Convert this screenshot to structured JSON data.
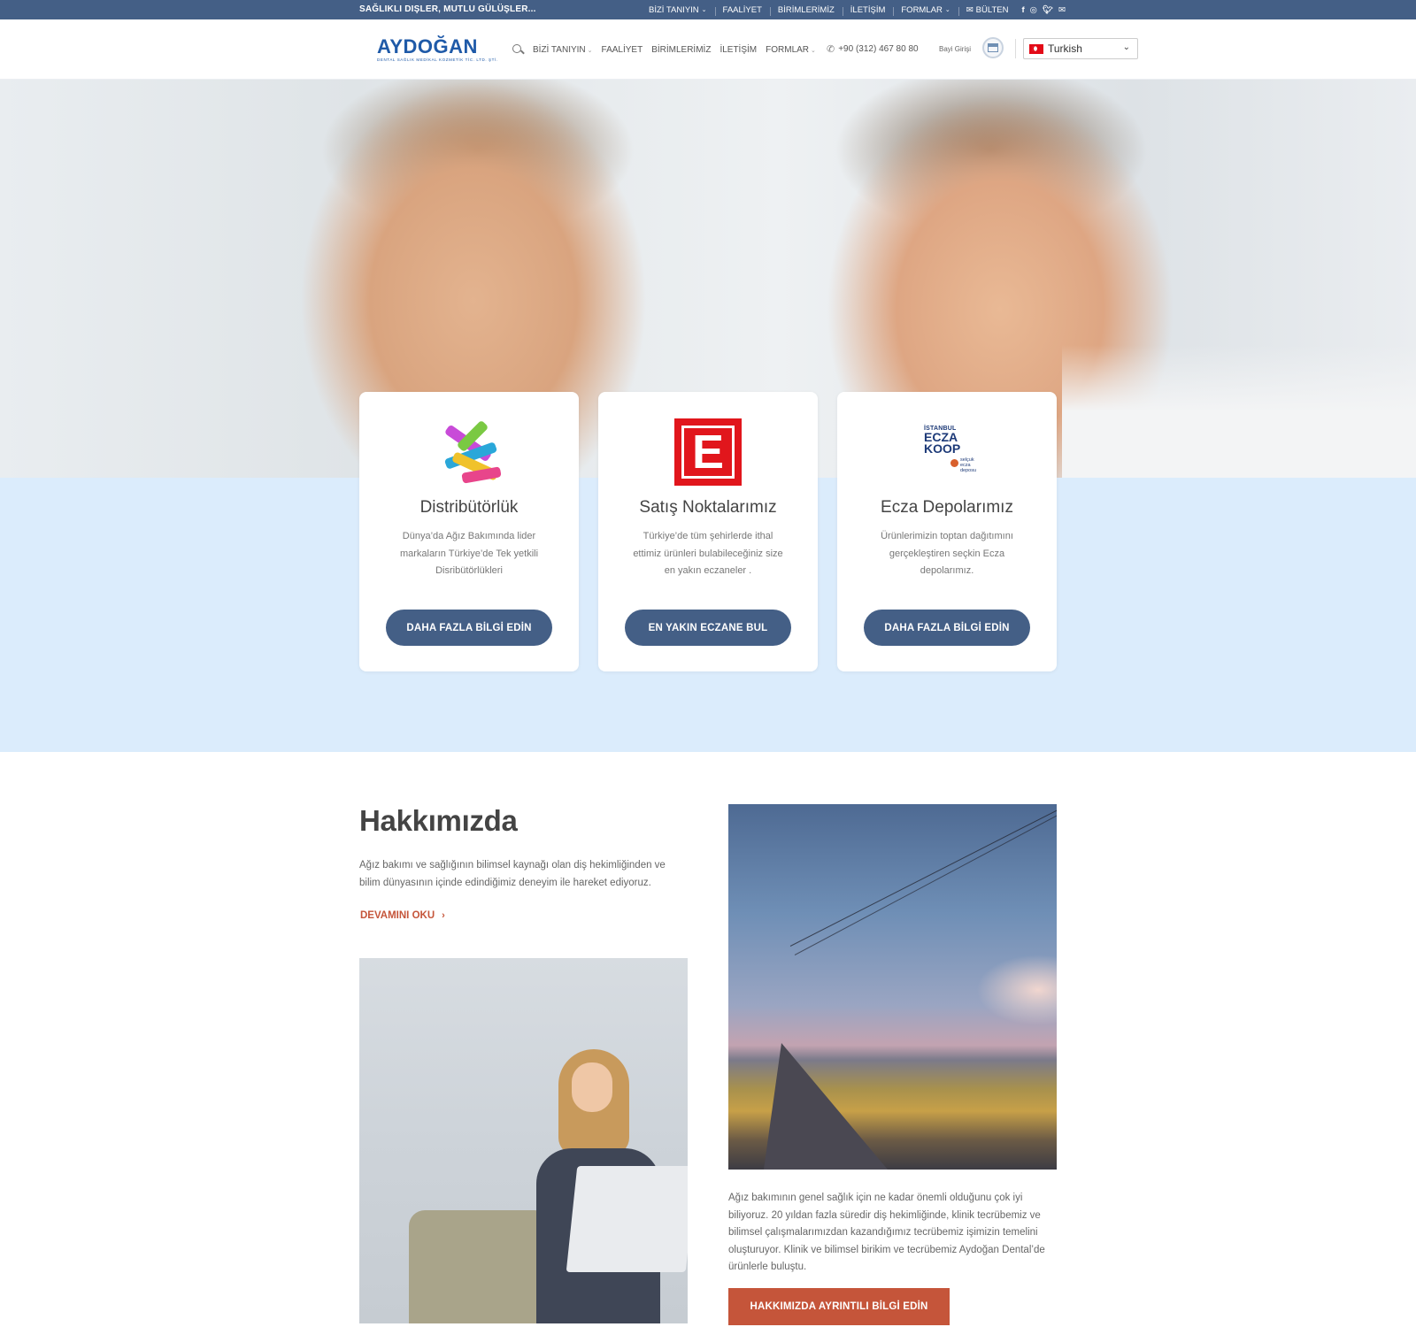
{
  "topbar": {
    "tagline": "SAĞLIKLI DIŞLER, MUTLU GÜLÜŞLER...",
    "nav": [
      {
        "label": "BİZİ TANIYIN",
        "has_dropdown": true
      },
      {
        "label": "FAALİYET",
        "has_dropdown": false
      },
      {
        "label": "BİRİMLERİMİZ",
        "has_dropdown": false
      },
      {
        "label": "İLETİŞİM",
        "has_dropdown": false
      },
      {
        "label": "FORMLAR",
        "has_dropdown": true
      },
      {
        "label": "BÜLTEN",
        "icon": "envelope-icon"
      }
    ],
    "social": [
      "facebook-icon",
      "instagram-icon",
      "twitter-icon",
      "email-icon"
    ],
    "color": "#445f86"
  },
  "header": {
    "logo_text": "AYDOĞAN",
    "logo_subtext": "DENTAL SAĞLIK MEDİKAL KOZMETİK TİC. LTD. ŞTİ.",
    "nav": [
      {
        "label": "BİZİ TANIYIN",
        "has_dropdown": true
      },
      {
        "label": "FAALİYET",
        "has_dropdown": false
      },
      {
        "label": "BİRİMLERİMİZ",
        "has_dropdown": false
      },
      {
        "label": "İLETİŞİM",
        "has_dropdown": false
      },
      {
        "label": "FORMLAR",
        "has_dropdown": true
      }
    ],
    "phone": "+90 (312) 467 80 80",
    "bayi_label": "Bayi Girişi",
    "language": "Turkish"
  },
  "cards": [
    {
      "title": "Distribütörlük",
      "description": "Dünya’da Ağız Bakımında lider markaların Türkiye’de Tek yetkili Disribütörlükleri",
      "button": "DAHA FAZLA BİLGİ EDİN",
      "icon": "toothbrushes-icon"
    },
    {
      "title": "Satış Noktalarımız",
      "description": "Türkiye’de tüm şehirlerde ithal ettimiz ürünleri bulabileceğiniz size en yakın eczaneler .",
      "button": "EN YAKIN ECZANE BUL",
      "icon": "pharmacy-e-icon"
    },
    {
      "title": "Ecza Depolarımız",
      "description": "Ürünlerimizin toptan dağıtımını gerçekleştiren seçkin Ecza depolarımız.",
      "button": "DAHA FAZLA BİLGİ EDİN",
      "icon": "istanbul-eczakoop-logo",
      "logo_lines": [
        "İSTANBUL",
        "ECZA",
        "KOOP",
        "selçuk ecza deposu"
      ]
    }
  ],
  "about": {
    "title": "Hakkımızda",
    "intro": "Ağız bakımı ve sağlığının bilimsel kaynağı olan diş hekimliğinden ve bilim dünyasının içinde edindiğimiz deneyim ile hareket ediyoruz.",
    "read_more": "DEVAMINI OKU",
    "body": "Ağız bakımının genel sağlık için ne kadar önemli olduğunu çok iyi biliyoruz. 20 yıldan fazla süredir diş hekimliğinde, klinik tecrübemiz ve bilimsel çalışmalarımızdan kazandığımız tecrübemiz işimizin temelini oluşturuyor. Klinik ve bilimsel birikim ve tecrübemiz Aydoğan Dental’de ürünlerle buluştu.",
    "button": "HAKKIMIZDA AYRINTILI BİLGİ EDİN"
  },
  "colors": {
    "primary": "#445f86",
    "accent": "#c5553a",
    "band": "#dbecfc"
  }
}
